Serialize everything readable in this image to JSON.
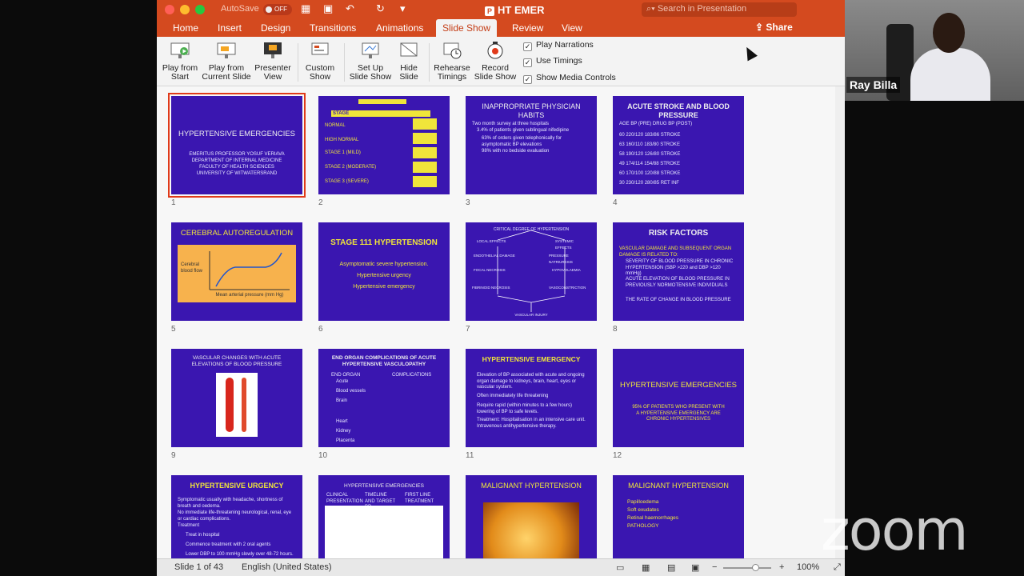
{
  "window": {
    "autosave_label": "AutoSave",
    "autosave_state": "OFF",
    "title": "HT EMER",
    "search_placeholder": "Search in Presentation",
    "share_label": "Share"
  },
  "menu": {
    "tabs": [
      "Home",
      "Insert",
      "Design",
      "Transitions",
      "Animations",
      "Slide Show",
      "Review",
      "View"
    ],
    "active": "Slide Show"
  },
  "ribbon": {
    "play_from_start": "Play from Start",
    "play_from_current": "Play from Current Slide",
    "presenter_view": "Presenter View",
    "custom_show": "Custom Show",
    "setup_show": "Set Up Slide Show",
    "hide_slide": "Hide Slide",
    "rehearse": "Rehearse Timings",
    "record": "Record Slide Show",
    "checks": [
      "Play Narrations",
      "Use Timings",
      "Show Media Controls"
    ]
  },
  "slides": [
    {
      "n": "1",
      "title": "HYPERTENSIVE EMERGENCIES",
      "lines": [
        "EMERITUS PROFESSOR YOSUF VERIAVA",
        "DEPARTMENT OF INTERNAL MEDICINE",
        "FACULTY OF HEALTH SCIENCES",
        "UNIVERSITY OF WITWATERSRAND"
      ]
    },
    {
      "n": "2",
      "title": "STAGE",
      "lines": [
        "NORMAL",
        "HIGH NORMAL",
        "STAGE 1 (MILD)",
        "STAGE 2 (MODERATE)",
        "STAGE 3 (SEVERE)"
      ]
    },
    {
      "n": "3",
      "title": "INAPPROPRIATE PHYSICIAN HABITS",
      "lines": [
        "Two month survey at three hospitals",
        "3.4% of patients given sublingual nifedipine",
        "63% of orders given telephonically for asymptomatic BP elevations",
        "98% with no bedside evaluation"
      ]
    },
    {
      "n": "4",
      "title": "ACUTE STROKE AND BLOOD PRESSURE",
      "lines": [
        "AGE  BP (PRE)  DRUG  BP (POST)",
        "60  220/120  183/86  STROKE",
        "63  160/110  183/80  STROKE",
        "58  190/120  126/80  STROKE",
        "49  174/114  154/88  STROKE",
        "60  170/100  120/88  STROKE",
        "30  230/120  280/85  RET INF"
      ]
    },
    {
      "n": "5",
      "title": "CEREBRAL AUTOREGULATION",
      "lines": [
        "Cerebral blood flow",
        "Mean arterial pressure (mm Hg)"
      ]
    },
    {
      "n": "6",
      "title": "STAGE 111 HYPERTENSION",
      "lines": [
        "Asymptomatic severe hypertension.",
        "Hypertensive urgency",
        "Hypertensive emergency"
      ]
    },
    {
      "n": "7",
      "title": "CRITICAL DEGREE OF HYPERTENSION",
      "lines": [
        "LOCAL EFFECTS",
        "SYSTEMIC EFFECTS",
        "ENDOTHELIAL DAMAGE",
        "PRESSURE NATRIURESIS",
        "FOCAL NECROSIS",
        "HYPOVOLAEMIA",
        "FIBRINOID NECROSIS",
        "VASOCONSTRICTION",
        "VASCULAR INJURY"
      ]
    },
    {
      "n": "8",
      "title": "RISK FACTORS",
      "lines": [
        "VASCULAR DAMAGE AND SUBSEQUENT ORGAN DAMAGE IS RELATED TO:",
        "SEVERITY OF BLOOD PRESSURE IN CHRONIC HYPERTENSION (SBP >220 and DBP >120 mmHg)",
        "ACUTE ELEVATION OF BLOOD PRESSURE IN PREVIOUSLY NORMOTENSIVE INDIVIDUALS",
        "THE RATE OF CHANGE IN BLOOD PRESSURE"
      ]
    },
    {
      "n": "9",
      "title": "VASCULAR CHANGES WITH ACUTE ELEVATIONS OF BLOOD PRESSURE",
      "lines": []
    },
    {
      "n": "10",
      "title": "END ORGAN COMPLICATIONS OF ACUTE HYPERTENSIVE VASCULOPATHY",
      "lines": [
        "END ORGAN",
        "COMPLICATIONS",
        "Acute",
        "Blood vessels",
        "Brain",
        "Heart",
        "Kidney",
        "Placenta"
      ]
    },
    {
      "n": "11",
      "title": "HYPERTENSIVE EMERGENCY",
      "lines": [
        "Elevation of BP associated with acute and ongoing organ damage to kidneys, brain, heart, eyes or vascular system.",
        "Often immediately life threatening",
        "Require rapid (within minutes to a few hours) lowering of BP to safe levels.",
        "Treatment: Hospitalisation in an intensive care unit. Intravenous antihypertensive therapy."
      ]
    },
    {
      "n": "12",
      "title": "HYPERTENSIVE EMERGENCIES",
      "lines": [
        "95% OF PATIENTS WHO PRESENT WITH A HYPERTENSIVE EMERGENCY ARE CHRONIC HYPERTENSIVES"
      ]
    },
    {
      "n": "13",
      "title": "HYPERTENSIVE URGENCY",
      "lines": [
        "Symptomatic usually with headache, shortness of breath and oedema.",
        "No immediate life-threatening neurological, renal, eye or cardiac complications.",
        "Treatment",
        "Treat in hospital",
        "Commence treatment with 2 oral agents",
        "Lower DBP to 100 mmHg slowly over 48-72 hours."
      ]
    },
    {
      "n": "14",
      "title": "HYPERTENSIVE EMERGENCIES",
      "lines": [
        "CLINICAL PRESENTATION",
        "TIMELINE AND TARGET BP",
        "FIRST LINE TREATMENT"
      ]
    },
    {
      "n": "15",
      "title": "MALIGNANT HYPERTENSION",
      "lines": []
    },
    {
      "n": "16",
      "title": "MALIGNANT HYPERTENSION",
      "lines": [
        "Papilloedema",
        "Soft exudates",
        "Retinal haemorrhages",
        "PATHOLOGY"
      ]
    }
  ],
  "status": {
    "slide_counter": "Slide 1 of 43",
    "language": "English (United States)",
    "zoom": "100%"
  },
  "participant": {
    "name": "Ray Billa"
  },
  "watermark": "zoom"
}
